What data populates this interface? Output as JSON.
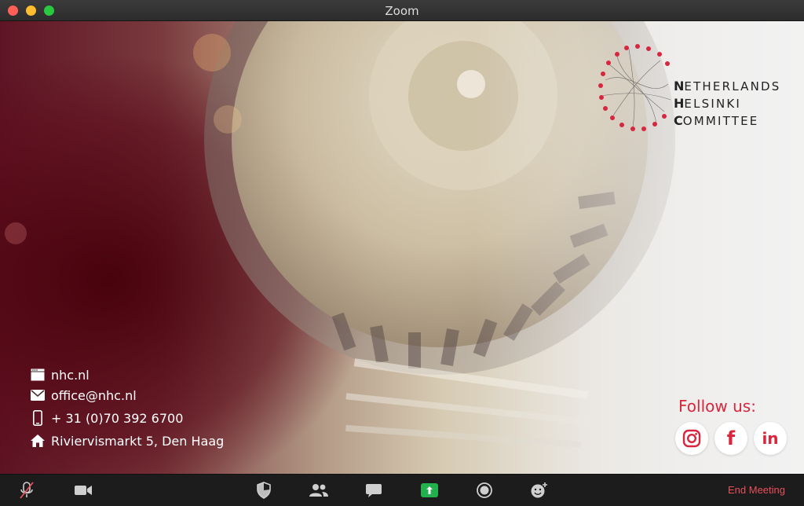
{
  "window": {
    "title": "Zoom"
  },
  "logo": {
    "line1_initial": "N",
    "line1_rest": "ETHERLANDS",
    "line2_initial": "H",
    "line2_rest": "ELSINKI",
    "line3_initial": "C",
    "line3_rest": "OMMITTEE",
    "accent_color": "#d7263d"
  },
  "contact": {
    "website": "nhc.nl",
    "email": "office@nhc.nl",
    "phone": "+ 31 (0)70 392 6700",
    "address": "Riviervismarkt 5, Den Haag",
    "icons": [
      "browser-icon",
      "envelope-icon",
      "phone-icon",
      "home-icon"
    ]
  },
  "follow": {
    "label": "Follow us:",
    "instagram_glyph": "instagram",
    "facebook_glyph": "f",
    "linkedin_glyph": "in",
    "color": "#d7263d"
  },
  "toolbar": {
    "buttons": [
      "mute-icon",
      "video-icon",
      "security-icon",
      "participants-icon",
      "chat-icon",
      "share-screen-icon",
      "record-icon",
      "reactions-icon"
    ],
    "end_meeting": "End Meeting",
    "end_color": "#e8505b",
    "share_color": "#22b14c"
  }
}
